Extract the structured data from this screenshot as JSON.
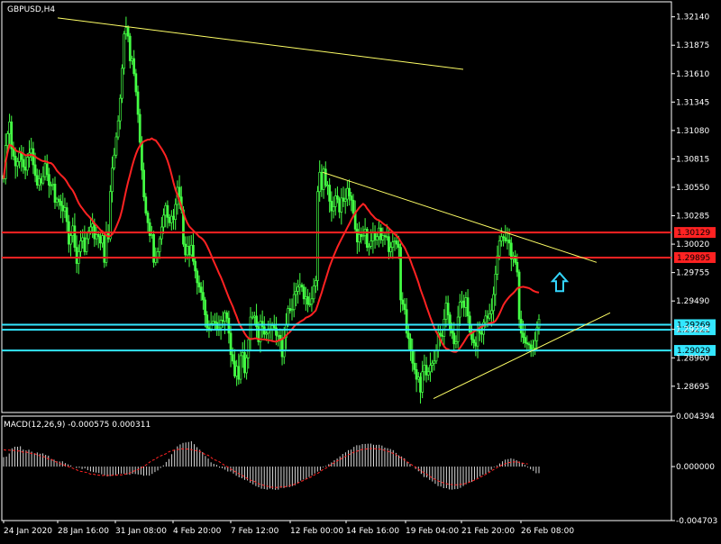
{
  "chart_data": {
    "type": "candlestick",
    "title": "GBPUSD,H4",
    "colors": {
      "background": "#000000",
      "candle": "#44ff44",
      "ma": "#ff2222",
      "trendline": "#ffff66",
      "resistance": "#ff2222",
      "support": "#33e6ff",
      "macd_hist": "#d8d8d8",
      "macd_signal": "#ff2222",
      "arrow": "#33d6ff",
      "label_red": "#ff2222",
      "label_cyan": "#33e6ff"
    },
    "price_axis": {
      "ticks": [
        "1.32140",
        "1.31875",
        "1.31610",
        "1.31345",
        "1.31080",
        "1.30815",
        "1.30550",
        "1.30285",
        "1.30020",
        "1.29755",
        "1.29490",
        "1.29225",
        "1.28960",
        "1.28695"
      ],
      "ylim": [
        1.2845,
        1.3228
      ]
    },
    "time_axis": {
      "ticks": [
        "24 Jan 2020",
        "28 Jan 16:00",
        "31 Jan 08:00",
        "4 Feb 20:00",
        "7 Feb 12:00",
        "12 Feb 00:00",
        "14 Feb 16:00",
        "19 Feb 04:00",
        "21 Feb 20:00",
        "26 Feb 08:00"
      ]
    },
    "price_series": {
      "name": "GBPUSD",
      "close": [
        1.3063,
        1.3094,
        1.3105,
        1.3116,
        1.3091,
        1.3084,
        1.3075,
        1.3079,
        1.3087,
        1.3081,
        1.3074,
        1.3071,
        1.3083,
        1.3087,
        1.3091,
        1.3076,
        1.3066,
        1.3057,
        1.3063,
        1.3059,
        1.3065,
        1.3077,
        1.3067,
        1.3057,
        1.3057,
        1.3058,
        1.3041,
        1.3044,
        1.3042,
        1.3038,
        1.3033,
        1.3036,
        1.3023,
        1.3002,
        1.301,
        1.3019,
        1.2999,
        1.2984,
        1.2995,
        1.3005,
        1.3008,
        1.2995,
        1.3007,
        1.3014,
        1.3018,
        1.3021,
        1.3007,
        1.3011,
        1.3009,
        1.3003,
        1.301,
        1.2985,
        1.3013,
        1.3007,
        1.3051,
        1.3073,
        1.3085,
        1.3102,
        1.3117,
        1.3138,
        1.3166,
        1.3198,
        1.3204,
        1.3196,
        1.3173,
        1.3175,
        1.3161,
        1.3144,
        1.3123,
        1.3097,
        1.3071,
        1.3046,
        1.3031,
        1.3022,
        1.301,
        1.3011,
        1.2985,
        1.299,
        1.2995,
        1.3007,
        1.3018,
        1.3029,
        1.3038,
        1.3027,
        1.3022,
        1.3028,
        1.3025,
        1.3039,
        1.3055,
        1.3046,
        1.3034,
        1.3002,
        1.2992,
        1.3,
        1.2992,
        1.3001,
        1.2986,
        1.2977,
        1.2966,
        1.2962,
        1.2957,
        1.295,
        1.2936,
        1.2924,
        1.2923,
        1.2928,
        1.293,
        1.2929,
        1.2923,
        1.2924,
        1.2931,
        1.293,
        1.2938,
        1.2933,
        1.2919,
        1.2899,
        1.2893,
        1.2879,
        1.2888,
        1.2876,
        1.2898,
        1.2901,
        1.2882,
        1.2896,
        1.2913,
        1.2934,
        1.2934,
        1.2935,
        1.2925,
        1.2911,
        1.293,
        1.2925,
        1.2918,
        1.2919,
        1.2923,
        1.2923,
        1.2926,
        1.2924,
        1.2917,
        1.2917,
        1.2913,
        1.2897,
        1.2915,
        1.2927,
        1.2942,
        1.294,
        1.2941,
        1.2955,
        1.2958,
        1.2962,
        1.2964,
        1.2962,
        1.2951,
        1.2953,
        1.2946,
        1.2946,
        1.2951,
        1.2963,
        1.2968,
        1.3051,
        1.3069,
        1.3053,
        1.3072,
        1.3057,
        1.3057,
        1.3042,
        1.3033,
        1.3037,
        1.3047,
        1.3044,
        1.3032,
        1.3045,
        1.3042,
        1.3044,
        1.3054,
        1.3047,
        1.3043,
        1.3031,
        1.3016,
        1.3004,
        1.3011,
        1.3009,
        1.301,
        1.3016,
        1.2999,
        1.3,
        1.3005,
        1.3013,
        1.3006,
        1.3009,
        1.3017,
        1.3006,
        1.301,
        1.3009,
        1.3009,
        1.2995,
        1.2999,
        1.3004,
        1.3005,
        1.3002,
        1.2999,
        1.295,
        1.2946,
        1.2941,
        1.2919,
        1.2914,
        1.2903,
        1.2891,
        1.2885,
        1.2876,
        1.2878,
        1.2864,
        1.2883,
        1.2889,
        1.288,
        1.2883,
        1.2889,
        1.2891,
        1.2893,
        1.2903,
        1.2919,
        1.2917,
        1.2916,
        1.2932,
        1.2947,
        1.2936,
        1.2922,
        1.2919,
        1.2909,
        1.2911,
        1.2934,
        1.2948,
        1.2949,
        1.2943,
        1.2952,
        1.2935,
        1.292,
        1.2913,
        1.291,
        1.2907,
        1.2921,
        1.2919,
        1.2918,
        1.2929,
        1.2935,
        1.2933,
        1.2937,
        1.294,
        1.2955,
        1.2974,
        1.2991,
        1.3005,
        1.3009,
        1.3008,
        1.3005,
        1.3006,
        1.3003,
        1.2988,
        1.2991,
        1.2985,
        1.2976,
        1.2932,
        1.2919,
        1.2915,
        1.291,
        1.2909,
        1.2908,
        1.2904,
        1.2905,
        1.2912,
        1.2924,
        1.2932
      ],
      "ma_last": 1.29895
    },
    "horizontal_lines": [
      {
        "label": "1.30129",
        "value": 1.30129,
        "kind": "resistance"
      },
      {
        "label": "1.29895",
        "value": 1.29895,
        "kind": "resistance"
      },
      {
        "label": "1.29222",
        "value": 1.29222,
        "kind": "support"
      },
      {
        "label": "1.29269",
        "value": 1.29269,
        "kind": "support"
      },
      {
        "label": "1.29029",
        "value": 1.29029,
        "kind": "support"
      }
    ],
    "macd": {
      "label": "MACD(12,26,9) -0.000575 0.000311",
      "ticks": [
        "0.004394",
        "0.000000",
        "-0.004703"
      ],
      "ylim": [
        -0.004703,
        0.004394
      ],
      "values": [
        0.00083,
        0.00087,
        0.00114,
        0.00159,
        0.00173,
        0.00173,
        0.00177,
        0.00148,
        0.00141,
        0.00147,
        0.0013,
        0.00116,
        0.00123,
        0.00112,
        0.00115,
        0.00102,
        0.00095,
        0.00066,
        0.0006,
        0.00046,
        0.00044,
        0.00046,
        0.0003,
        0.00019,
        0.0001,
        1e-05,
        -0.00012,
        -0.0001,
        -0.00022,
        -0.00016,
        -0.00031,
        -0.00042,
        -0.00048,
        -0.00052,
        -0.00056,
        -0.00067,
        -0.00078,
        -0.00086,
        -0.00083,
        -0.00074,
        -0.00077,
        -0.00066,
        -0.00061,
        -0.00063,
        -0.0007,
        -0.00072,
        -0.00063,
        -0.00065,
        -0.00069,
        -0.0007,
        -0.0008,
        -0.00076,
        -0.00079,
        -0.00064,
        -0.00048,
        -0.00034,
        -0.00012,
        0.00011,
        0.0004,
        0.00066,
        0.00108,
        0.00148,
        0.00176,
        0.00193,
        0.00206,
        0.0021,
        0.00214,
        0.00221,
        0.00195,
        0.00169,
        0.00147,
        0.00126,
        0.00092,
        0.0007,
        0.00037,
        0.00024,
        0.00015,
        -9e-05,
        -0.00014,
        -0.00027,
        -0.00043,
        -0.00043,
        -0.00061,
        -0.0008,
        -0.00094,
        -0.00102,
        -0.00116,
        -0.00121,
        -0.00141,
        -0.00155,
        -0.0017,
        -0.0018,
        -0.00193,
        -0.00196,
        -0.00201,
        -0.00192,
        -0.00198,
        -0.00203,
        -0.00201,
        -0.00185,
        -0.00187,
        -0.00179,
        -0.00179,
        -0.0017,
        -0.00162,
        -0.00146,
        -0.00122,
        -0.00113,
        -0.00107,
        -0.00091,
        -0.00077,
        -0.0006,
        -0.00044,
        -0.00034,
        -6e-05,
        6e-05,
        0.00021,
        0.00036,
        0.00055,
        0.0007,
        0.00089,
        0.0011,
        0.00124,
        0.00143,
        0.00148,
        0.00172,
        0.00186,
        0.00186,
        0.00196,
        0.00197,
        0.00199,
        0.002,
        0.0019,
        0.00189,
        0.0019,
        0.00183,
        0.00165,
        0.0016,
        0.00153,
        0.00143,
        0.00119,
        0.00098,
        0.00088,
        0.00072,
        0.00043,
        0.00021,
        -1e-05,
        -0.00021,
        -0.00041,
        -0.00064,
        -0.00091,
        -0.00095,
        -0.00116,
        -0.0013,
        -0.0015,
        -0.0017,
        -0.00174,
        -0.00188,
        -0.00188,
        -0.00199,
        -0.00201,
        -0.00197,
        -0.00195,
        -0.00185,
        -0.0017,
        -0.00154,
        -0.0014,
        -0.00134,
        -0.00114,
        -0.001,
        -0.00086,
        -0.00071,
        -0.00063,
        -0.00046,
        -0.00028,
        -6e-05,
        9e-05,
        0.00027,
        0.00046,
        0.00061,
        0.00065,
        0.00072,
        0.00066,
        0.00055,
        0.00044,
        0.00033,
        0.00014,
        -7e-05,
        -0.00024,
        -0.00038,
        -0.00058,
        -0.00058
      ],
      "signal": [
        0.00146,
        0.00142,
        0.00144,
        0.0014,
        0.00141,
        0.00134,
        0.00137,
        0.00123,
        0.00127,
        0.0012,
        0.00113,
        0.00114,
        0.001,
        0.00093,
        0.00087,
        0.00082,
        0.00065,
        0.00064,
        0.00047,
        0.00038,
        0.00025,
        0.00021,
        8e-05,
        0.0,
        -6e-05,
        -0.00018,
        -0.00027,
        -0.0004,
        -0.00044,
        -0.00048,
        -0.00055,
        -0.00066,
        -0.00066,
        -0.00072,
        -0.00074,
        -0.00078,
        -0.00076,
        -0.00078,
        -0.00076,
        -0.00076,
        -0.00076,
        -0.0007,
        -0.00073,
        -0.00069,
        -0.00061,
        -0.00057,
        -0.00045,
        -0.00033,
        -0.00026,
        -0.00013,
        1e-05,
        0.00017,
        0.00036,
        0.00053,
        0.00062,
        0.0008,
        0.00093,
        0.00102,
        0.00112,
        0.00129,
        0.00138,
        0.00143,
        0.00147,
        0.00153,
        0.00155,
        0.00151,
        0.00154,
        0.00148,
        0.00141,
        0.00138,
        0.00132,
        0.00116,
        0.00105,
        0.00098,
        0.0008,
        0.00061,
        0.00053,
        0.00041,
        0.00024,
        9e-05,
        -4e-05,
        -0.00019,
        -0.00036,
        -0.00049,
        -0.00063,
        -0.00075,
        -0.0009,
        -0.00105,
        -0.00118,
        -0.00124,
        -0.00136,
        -0.00151,
        -0.00155,
        -0.00165,
        -0.0017,
        -0.00177,
        -0.0018,
        -0.00182,
        -0.00181,
        -0.00178,
        -0.00176,
        -0.00173,
        -0.00167,
        -0.0016,
        -0.00153,
        -0.00143,
        -0.00129,
        -0.00121,
        -0.00107,
        -0.001,
        -0.00085,
        -0.00071,
        -0.0006,
        -0.00044,
        -0.00025,
        -0.00014,
        2e-05,
        0.0002,
        0.00035,
        0.0005,
        0.00061,
        0.00077,
        0.00089,
        0.00104,
        0.00112,
        0.00126,
        0.00133,
        0.00142,
        0.0015,
        0.00151,
        0.00156,
        0.00156,
        0.00157,
        0.00153,
        0.00153,
        0.00149,
        0.0014,
        0.00134,
        0.00124,
        0.00114,
        0.00102,
        0.00085,
        0.00073,
        0.00058,
        0.00041,
        0.00025,
        9e-05,
        -6e-05,
        -0.00021,
        -0.00041,
        -0.00053,
        -0.00067,
        -0.00084,
        -0.001,
        -0.00112,
        -0.00124,
        -0.00134,
        -0.00143,
        -0.00149,
        -0.00155,
        -0.00157,
        -0.0016,
        -0.00159,
        -0.00155,
        -0.00151,
        -0.00147,
        -0.00138,
        -0.00127,
        -0.00118,
        -0.00107,
        -0.00094,
        -0.00081,
        -0.00068,
        -0.00054,
        -0.00039,
        -0.00024,
        -9e-05,
        3e-05,
        0.00015,
        0.00025,
        0.00033,
        0.00038,
        0.00041,
        0.0004,
        0.00037,
        0.00031,
        0.00025,
        0.00023
      ]
    }
  }
}
